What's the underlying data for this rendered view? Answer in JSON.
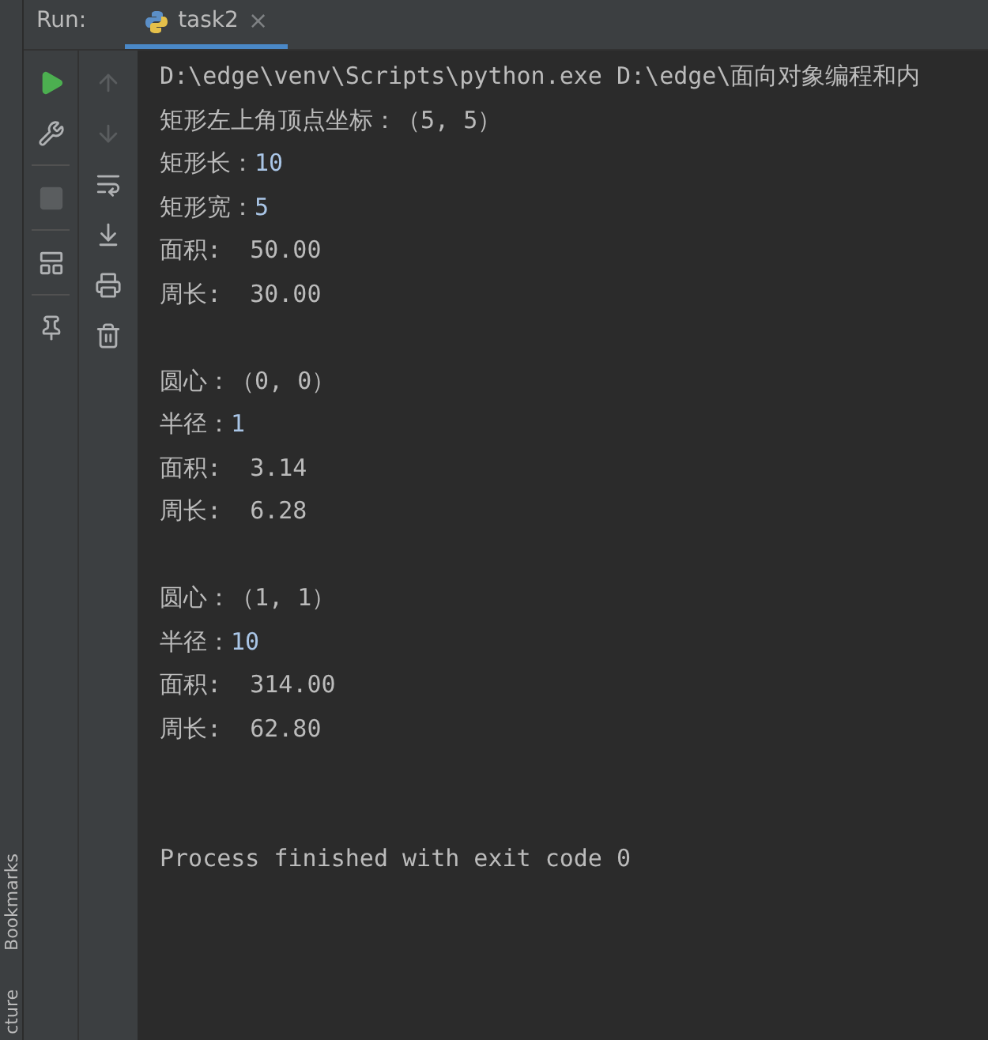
{
  "side_strip": {
    "labels": [
      "Bookmarks",
      "cture"
    ]
  },
  "run_bar": {
    "label": "Run:",
    "tabs": [
      {
        "label": "task2",
        "selected": true,
        "close": "×"
      }
    ]
  },
  "toolbar_left": [
    {
      "kind": "run",
      "disabled": false
    },
    {
      "kind": "wrench",
      "disabled": false
    },
    {
      "kind": "stop",
      "disabled": true
    },
    {
      "kind": "layout",
      "disabled": false
    },
    {
      "kind": "pin",
      "disabled": false
    }
  ],
  "toolbar_right": [
    {
      "kind": "up",
      "disabled": true
    },
    {
      "kind": "down",
      "disabled": true
    },
    {
      "kind": "wrap",
      "disabled": false
    },
    {
      "kind": "scroll-end",
      "disabled": false
    },
    {
      "kind": "print",
      "disabled": false
    },
    {
      "kind": "trash",
      "disabled": false
    }
  ],
  "console": {
    "blocks": [
      [
        [
          {
            "kind": "output",
            "text": "D:\\edge\\venv\\Scripts\\python.exe D:\\edge\\面向对象编程和内"
          }
        ],
        [
          {
            "kind": "output",
            "text": "矩形左上角顶点坐标：（5, 5）"
          }
        ],
        [
          {
            "kind": "output",
            "text": "矩形长："
          },
          {
            "kind": "input",
            "text": "10"
          }
        ],
        [
          {
            "kind": "output",
            "text": "矩形宽："
          },
          {
            "kind": "input",
            "text": "5"
          }
        ],
        [
          {
            "kind": "output",
            "text": "面积:  50.00"
          }
        ],
        [
          {
            "kind": "output",
            "text": "周长:  30.00"
          }
        ]
      ],
      [
        [
          {
            "kind": "output",
            "text": "圆心：（0, 0）"
          }
        ],
        [
          {
            "kind": "output",
            "text": "半径："
          },
          {
            "kind": "input",
            "text": "1"
          }
        ],
        [
          {
            "kind": "output",
            "text": "面积:  3.14"
          }
        ],
        [
          {
            "kind": "output",
            "text": "周长:  6.28"
          }
        ]
      ],
      [
        [
          {
            "kind": "output",
            "text": "圆心：（1, 1）"
          }
        ],
        [
          {
            "kind": "output",
            "text": "半径："
          },
          {
            "kind": "input",
            "text": "10"
          }
        ],
        [
          {
            "kind": "output",
            "text": "面积:  314.00"
          }
        ],
        [
          {
            "kind": "output",
            "text": "周长:  62.80"
          }
        ]
      ]
    ],
    "exit_message": "Process finished with exit code 0"
  }
}
